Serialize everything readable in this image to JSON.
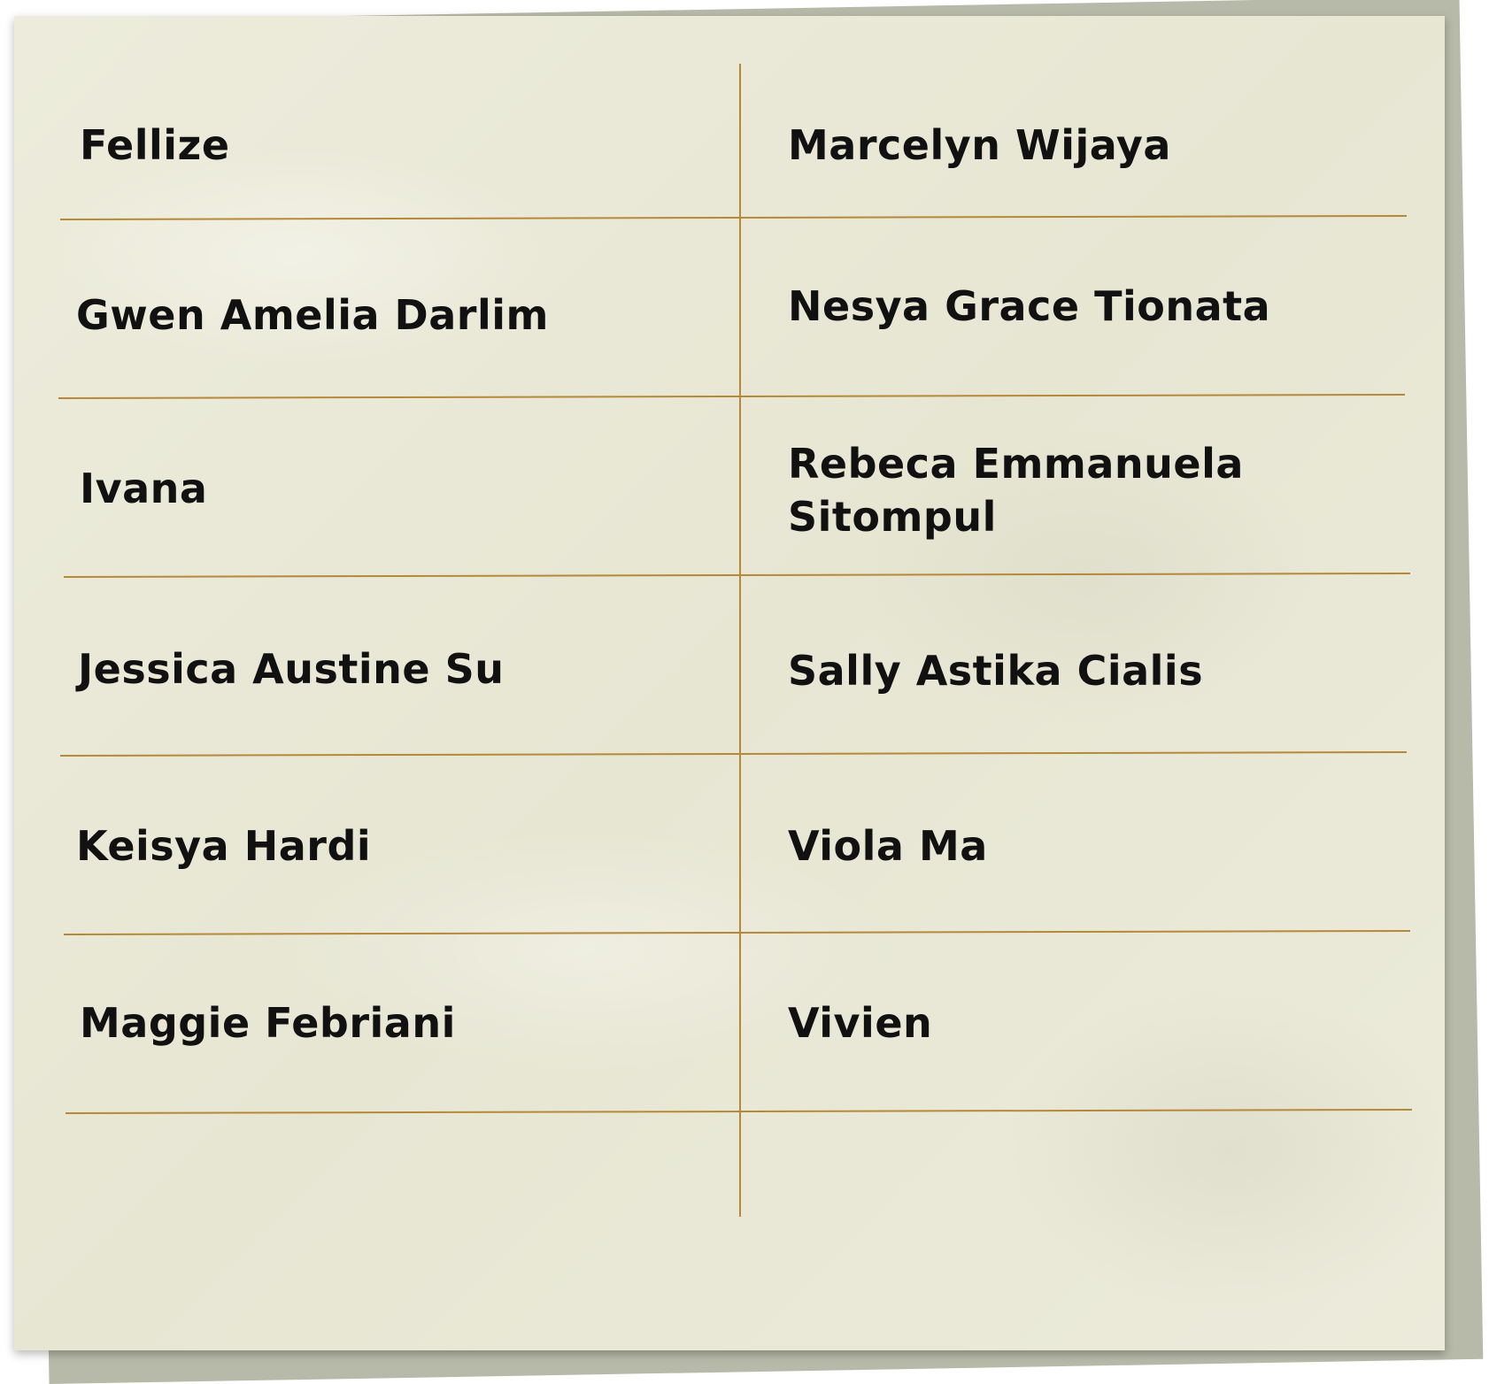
{
  "table": {
    "rows": [
      {
        "left": "Fellize",
        "right": "Marcelyn Wijaya"
      },
      {
        "left": "Gwen Amelia Darlim",
        "right": "Nesya Grace Tionata"
      },
      {
        "left": "Ivana",
        "right": "Rebeca Emmanuela Sitompul"
      },
      {
        "left": "Jessica Austine Su",
        "right": "Sally Astika Cialis"
      },
      {
        "left": "Keisya Hardi",
        "right": "Viola Ma"
      },
      {
        "left": "Maggie Febriani",
        "right": "Vivien"
      }
    ]
  },
  "colors": {
    "paper": "#ebe9d8",
    "back_sheet": "#b7b9a9",
    "rule_line": "#b5893a",
    "text": "#111111"
  }
}
